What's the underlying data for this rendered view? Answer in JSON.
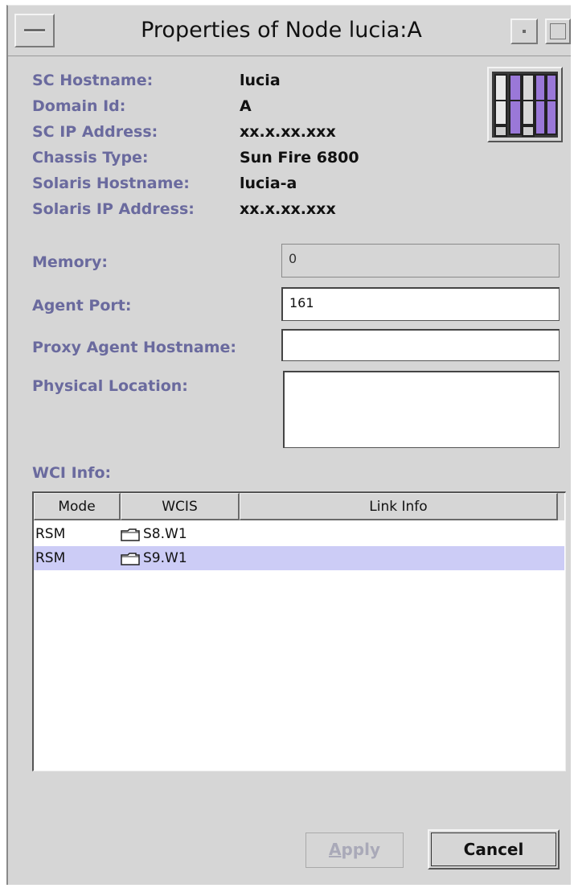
{
  "window": {
    "title": "Properties of Node lucia:A"
  },
  "info": {
    "sc_hostname_label": "SC Hostname:",
    "sc_hostname_value": "lucia",
    "domain_id_label": "Domain Id:",
    "domain_id_value": "A",
    "sc_ip_label": "SC IP Address:",
    "sc_ip_value": "xx.x.xx.xxx",
    "chassis_type_label": "Chassis Type:",
    "chassis_type_value": "Sun Fire 6800",
    "solaris_hostname_label": "Solaris Hostname:",
    "solaris_hostname_value": "lucia-a",
    "solaris_ip_label": "Solaris IP Address:",
    "solaris_ip_value": "xx.x.xx.xxx"
  },
  "form": {
    "memory_label": "Memory:",
    "memory_value": "0",
    "agent_port_label": "Agent Port:",
    "agent_port_value": "161",
    "proxy_label": "Proxy Agent Hostname:",
    "proxy_value": "",
    "location_label": "Physical Location:",
    "location_value": ""
  },
  "wci": {
    "section_label": "WCI Info:",
    "columns": [
      "Mode",
      "WCIS",
      "Link Info"
    ],
    "rows": [
      {
        "mode": "RSM",
        "wcis": "S8.W1",
        "link": ""
      },
      {
        "mode": "RSM",
        "wcis": "S9.W1",
        "link": ""
      }
    ],
    "selected_row": 1
  },
  "buttons": {
    "apply_prefix": "A",
    "apply_rest": "pply",
    "cancel": "Cancel"
  },
  "colors": {
    "label": "#6a6a9e",
    "selection": "#ccccf6",
    "icon_purple": "#9a78d8",
    "window_bg": "#d6d6d6"
  },
  "icons": [
    "window-menu-icon",
    "minimize-icon",
    "maximize-icon",
    "node-chassis-icon",
    "folder-icon"
  ]
}
